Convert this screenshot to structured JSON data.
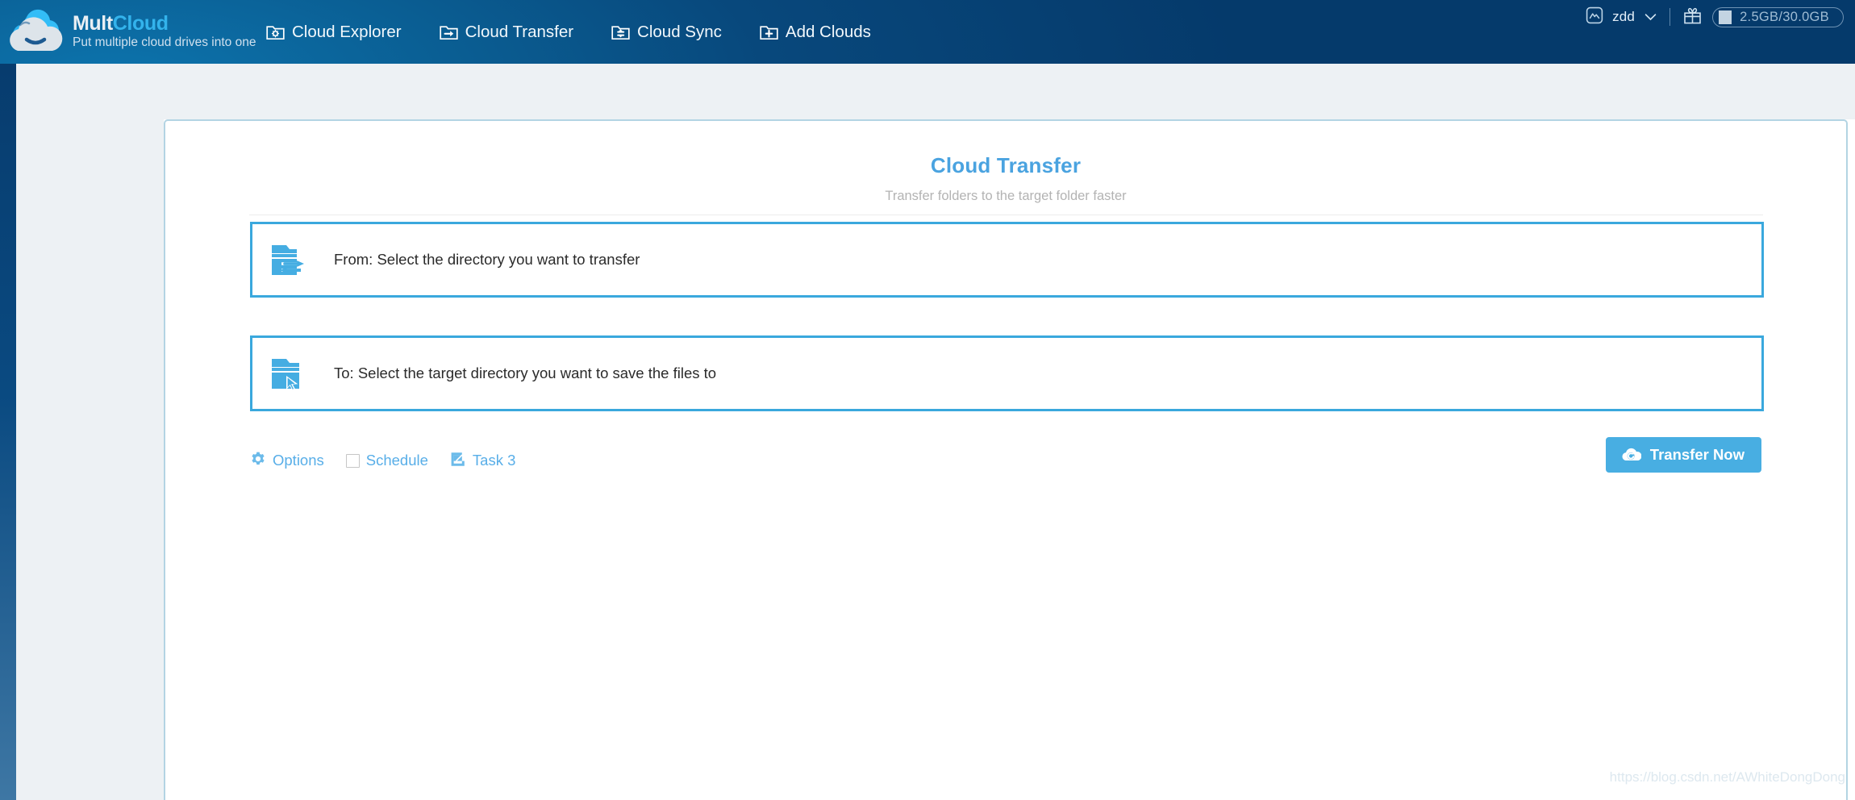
{
  "header": {
    "logo_icon": "cloud-logo-icon",
    "brand_primary": "Mult",
    "brand_secondary": "Cloud",
    "tagline": "Put multiple cloud drives into one",
    "nav": [
      {
        "label": "Cloud Explorer",
        "icon": "folder-gear-icon"
      },
      {
        "label": "Cloud Transfer",
        "icon": "folder-arrow-right-icon"
      },
      {
        "label": "Cloud Sync",
        "icon": "folder-sync-icon"
      },
      {
        "label": "Add Clouds",
        "icon": "folder-plus-icon"
      }
    ],
    "account": {
      "user_icon": "user-avatar-icon",
      "user_name": "zdd",
      "chevron_icon": "chevron-down-icon",
      "gift_icon": "gift-icon",
      "storage_text": "2.5GB/30.0GB"
    }
  },
  "main": {
    "title": "Cloud Transfer",
    "subtitle": "Transfer folders to the target folder faster",
    "source": {
      "icon": "folder-transfer-from-icon",
      "label": "From: Select the directory you want to transfer"
    },
    "target": {
      "icon": "folder-pointer-to-icon",
      "label": "To: Select the target directory you want to save the files to"
    },
    "options_row": {
      "options": {
        "label": "Options",
        "icon": "gear-icon"
      },
      "schedule": {
        "label": "Schedule",
        "icon": "checkbox-unchecked-icon",
        "checked": false
      },
      "task": {
        "label": "Task 3",
        "icon": "edit-pencil-icon"
      }
    },
    "transfer_button": {
      "label": "Transfer Now",
      "icon": "cloud-transfer-icon"
    }
  },
  "watermark": "https://blog.csdn.net/AWhiteDongDong",
  "colors": {
    "accent_blue": "#48aee2",
    "header_navy": "#053a6b",
    "box_border": "#3aa8dd",
    "card_border": "#b3d4e3",
    "page_bg": "#edf1f4"
  }
}
